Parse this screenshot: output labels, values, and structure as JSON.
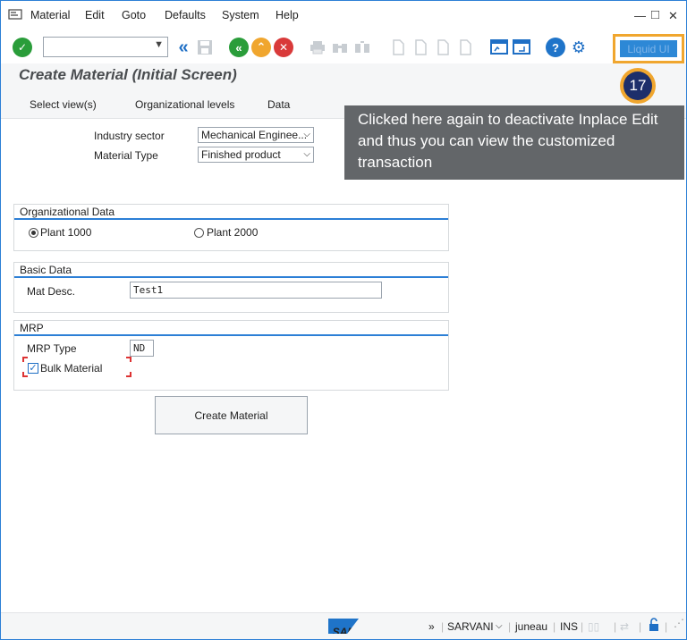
{
  "menu": {
    "items": [
      "Material",
      "Edit",
      "Goto",
      "Defaults",
      "System",
      "Help"
    ]
  },
  "window_controls": {
    "minimize": "—",
    "maximize": "□",
    "close": "✕"
  },
  "toolbar": {
    "liquid_ui_label": "Liquid UI"
  },
  "page": {
    "title": "Create Material (Initial Screen)"
  },
  "subtoolbar": {
    "select_views": "Select view(s)",
    "org_levels": "Organizational levels",
    "data": "Data"
  },
  "form": {
    "industry_sector_label": "Industry sector",
    "industry_sector_value": "Mechanical Enginee...",
    "material_type_label": "Material Type",
    "material_type_value": "Finished product"
  },
  "org_data": {
    "title": "Organizational Data",
    "plant1": "Plant 1000",
    "plant2": "Plant 2000",
    "selected": "Plant 1000"
  },
  "basic_data": {
    "title": "Basic Data",
    "mat_desc_label": "Mat Desc.",
    "mat_desc_value": "Test1"
  },
  "mrp": {
    "title": "MRP",
    "mrp_type_label": "MRP Type",
    "mrp_type_value": "ND",
    "bulk_label": "Bulk Material",
    "bulk_checked": true
  },
  "actions": {
    "create_label": "Create Material"
  },
  "tooltip": {
    "step": "17",
    "text": "Clicked here again to deactivate Inplace Edit and thus you can view the customized transaction"
  },
  "statusbar": {
    "logo": "SAP",
    "system": "SARVANI",
    "server": "juneau",
    "mode": "INS",
    "expand": "»"
  },
  "colors": {
    "accent": "#2c7fd6",
    "highlight": "#f0a62e",
    "badge": "#1d2f6b",
    "tooltip_bg": "#636669"
  }
}
